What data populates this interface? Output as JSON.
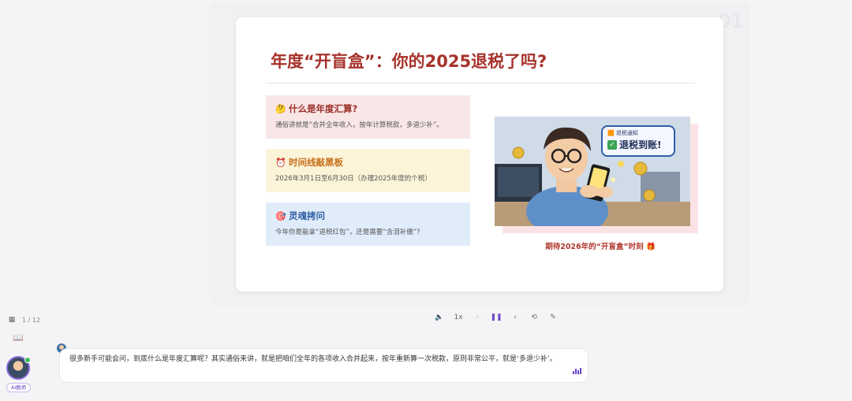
{
  "slide": {
    "number": "01",
    "title": "年度“开盲盒”：你的2025退税了吗?",
    "cards": [
      {
        "emoji": "🤔",
        "title": "什么是年度汇算?",
        "body": "通俗讲就是“合并全年收入，按年计算税款，多退少补”。"
      },
      {
        "emoji": "⏰",
        "title": "时间线敲黑板",
        "body": "2026年3月1日至6月30日（办理2025年度的个税）"
      },
      {
        "emoji": "🎯",
        "title": "灵魂拷问",
        "body": "今年你是能拿“退税红包”，还是需要“含泪补缴”?"
      }
    ],
    "image": {
      "bubble_small": "退税通知",
      "bubble_big": "退税到账!"
    },
    "caption": "期待2026年的“开盲盒”时刻 🎁"
  },
  "toolbar": {
    "page_indicator": "1 / 12",
    "speed": "1x",
    "icons": [
      "grid-icon",
      "volume-icon",
      "prev-icon",
      "pause-icon",
      "next-icon",
      "loop-icon",
      "pen-icon"
    ]
  },
  "chat": {
    "ai_label": "AI教师",
    "message": "很多新手可能会问，到底什么是年度汇算呢？其实通俗来讲，就是把咱们全年的各项收入合并起来，按年重新算一次税款，原则非常公平，就是‘多退少补’。"
  },
  "colors": {
    "title_red": "#a6322b",
    "accent_purple": "#6b47c9"
  }
}
